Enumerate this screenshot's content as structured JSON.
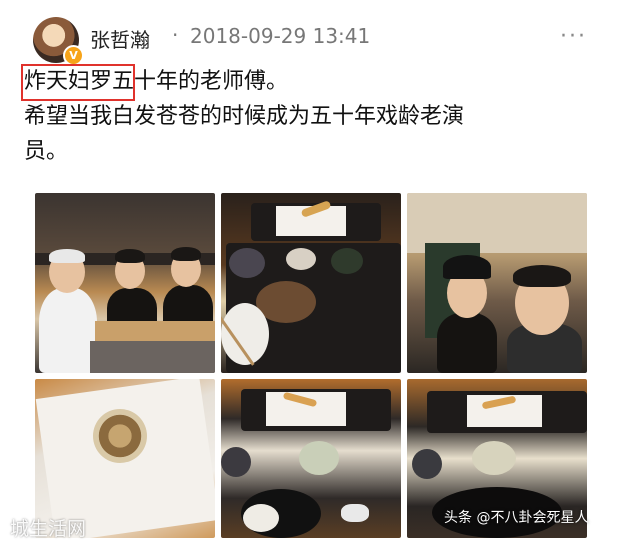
{
  "post": {
    "author": "张哲瀚",
    "separator": "·",
    "timestamp": "2018-09-29 13:41",
    "verified_badge": "V",
    "more_icon": "···",
    "text_lines": [
      "炸天妇罗五十年的老师傅。",
      "希望当我白发苍苍的时候成为五十年戏龄老演",
      "员。"
    ],
    "highlight_color": "#e0322c",
    "badge_color": "#f7a41a"
  },
  "photos": [
    {
      "id": "photo-1",
      "subject": "chef-with-two-men"
    },
    {
      "id": "photo-2",
      "subject": "tempura-dinner-table"
    },
    {
      "id": "photo-3",
      "subject": "two-men-selfie"
    },
    {
      "id": "photo-4",
      "subject": "tempura-on-paper"
    },
    {
      "id": "photo-5",
      "subject": "tempura-set-plates"
    },
    {
      "id": "photo-6",
      "subject": "tempura-plate-sauce"
    }
  ],
  "watermarks": {
    "left": "城生活网",
    "right": "头条 @不八卦会死星人"
  }
}
